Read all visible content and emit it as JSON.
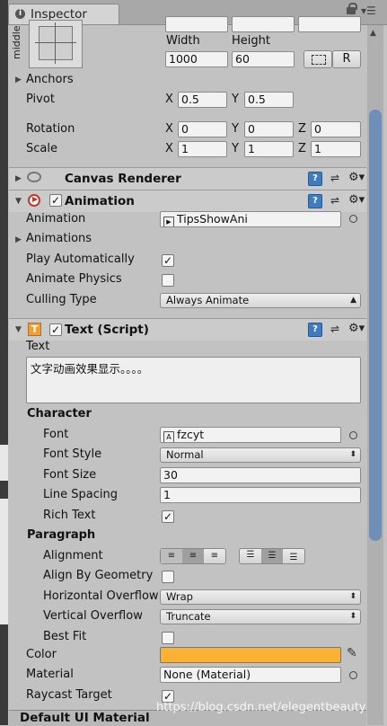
{
  "window": {
    "tab_title": "Inspector"
  },
  "rect": {
    "anchor_preset_label": "middle",
    "width_label": "Width",
    "height_label": "Height",
    "width_value": "1000",
    "height_value": "60",
    "raw_edit_button": "R",
    "anchors_label": "Anchors",
    "pivot_label": "Pivot",
    "pivot_x": "0.5",
    "pivot_y": "0.5",
    "rotation_label": "Rotation",
    "rotation_x": "0",
    "rotation_y": "0",
    "rotation_z": "0",
    "scale_label": "Scale",
    "scale_x": "1",
    "scale_y": "1",
    "scale_z": "1",
    "axis_x": "X",
    "axis_y": "Y",
    "axis_z": "Z"
  },
  "canvas_renderer": {
    "title": "Canvas Renderer"
  },
  "animation": {
    "title": "Animation",
    "animation_label": "Animation",
    "animation_value": "TipsShowAni",
    "animations_label": "Animations",
    "play_auto_label": "Play Automatically",
    "animate_physics_label": "Animate Physics",
    "culling_label": "Culling Type",
    "culling_value": "Always Animate"
  },
  "text": {
    "title": "Text (Script)",
    "text_label": "Text",
    "text_value": "文字动画效果显示。。。。",
    "character_label": "Character",
    "font_label": "Font",
    "font_value": "fzcyt",
    "font_style_label": "Font Style",
    "font_style_value": "Normal",
    "font_size_label": "Font Size",
    "font_size_value": "30",
    "line_spacing_label": "Line Spacing",
    "line_spacing_value": "1",
    "rich_text_label": "Rich Text",
    "paragraph_label": "Paragraph",
    "alignment_label": "Alignment",
    "align_geometry_label": "Align By Geometry",
    "horizontal_overflow_label": "Horizontal Overflow",
    "horizontal_overflow_value": "Wrap",
    "vertical_overflow_label": "Vertical Overflow",
    "vertical_overflow_value": "Truncate",
    "best_fit_label": "Best Fit",
    "color_label": "Color",
    "color_value": "#f9b233",
    "material_label": "Material",
    "material_value": "None (Material)",
    "raycast_label": "Raycast Target"
  },
  "footer": {
    "material_title": "Default UI Material"
  },
  "watermark": "https://blog.csdn.net/elegentbeauty",
  "colors": {
    "panel_bg": "#c2c2c2",
    "scrollbar_thumb": "#6e8fb8",
    "help_blue": "#3f7bc0"
  }
}
